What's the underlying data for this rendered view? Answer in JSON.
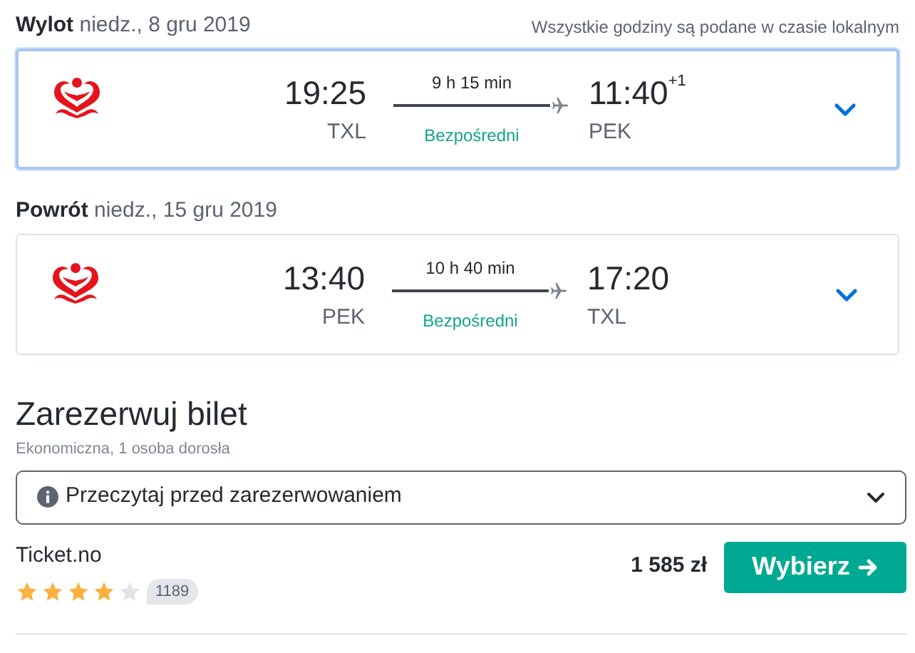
{
  "legs": [
    {
      "label": "Wylot",
      "date": "niedz., 8 gru 2019",
      "note": "Wszystkie godziny są podane w czasie lokalnym",
      "selected": true,
      "departure_time": "19:25",
      "departure_airport": "TXL",
      "duration": "9 h 15 min",
      "stops": "Bezpośredni",
      "arrival_time": "11:40",
      "arrival_day_offset": "+1",
      "arrival_airport": "PEK"
    },
    {
      "label": "Powrót",
      "date": "niedz., 15 gru 2019",
      "selected": false,
      "departure_time": "13:40",
      "departure_airport": "PEK",
      "duration": "10 h 40 min",
      "stops": "Bezpośredni",
      "arrival_time": "17:20",
      "arrival_airport": "TXL"
    }
  ],
  "booking": {
    "title": "Zarezerwuj bilet",
    "subtitle": "Ekonomiczna, 1 osoba dorosła",
    "notice": "Przeczytaj przed zarezerwowaniem",
    "offer": {
      "provider": "Ticket.no",
      "stars": 4,
      "reviews": "1189",
      "price": "1 585 zł",
      "button": "Wybierz"
    }
  }
}
